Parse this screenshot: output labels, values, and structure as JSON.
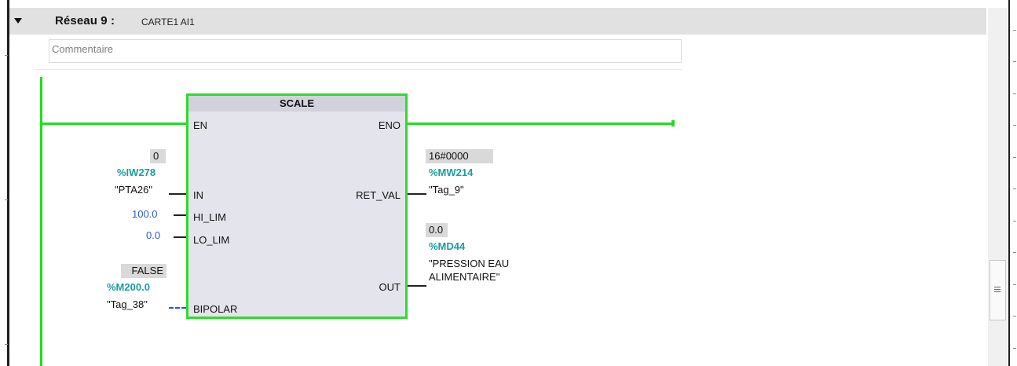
{
  "network": {
    "title": "Réseau 9 :",
    "name": "CARTE1 AI1",
    "comment_placeholder": "Commentaire"
  },
  "block": {
    "title": "SCALE",
    "pins_in": [
      "EN",
      "IN",
      "HI_LIM",
      "LO_LIM",
      "BIPOLAR"
    ],
    "pins_out": [
      "ENO",
      "RET_VAL",
      "OUT"
    ]
  },
  "inputs": {
    "in": {
      "value": "0",
      "address": "%IW278",
      "tag": "\"PTA26\""
    },
    "hi_lim": {
      "const": "100.0"
    },
    "lo_lim": {
      "const": "0.0"
    },
    "bipolar": {
      "value": "FALSE",
      "address": "%M200.0",
      "tag": "\"Tag_38\""
    }
  },
  "outputs": {
    "ret_val": {
      "value": "16#0000",
      "address": "%MW214",
      "tag": "\"Tag_9\""
    },
    "out": {
      "value": "0.0",
      "address": "%MD44",
      "tag_line1": "\"PRESSION EAU",
      "tag_line2": "ALIMENTAIRE\""
    }
  },
  "colors": {
    "power_flow": "#22dd22",
    "address": "#1a9e9e",
    "constant": "#2f57d6",
    "header_bg": "#e1e1e1"
  },
  "icons": [
    "collapse-triangle-icon",
    "scroll-grip-icon"
  ]
}
